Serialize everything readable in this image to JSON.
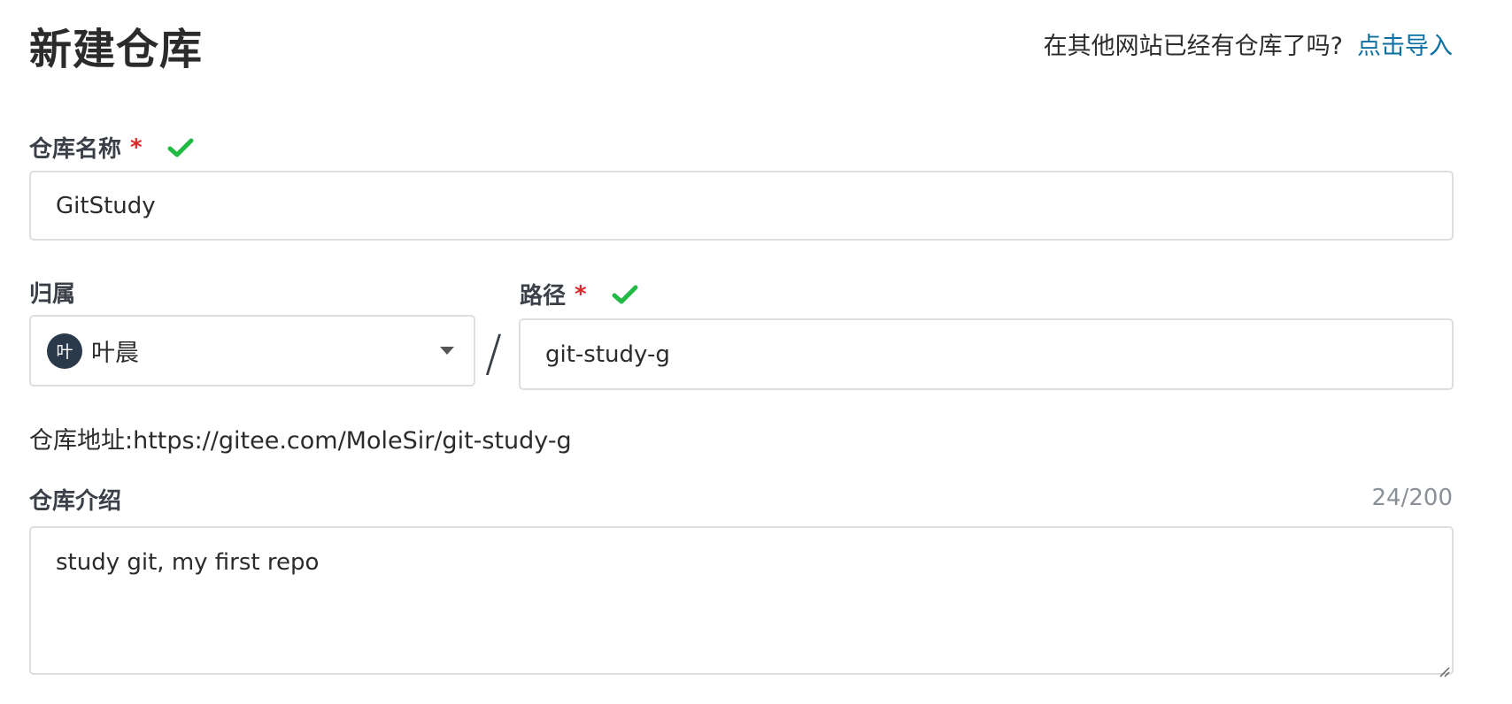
{
  "header": {
    "title": "新建仓库",
    "import_hint": "在其他网站已经有仓库了吗?",
    "import_link": "点击导入"
  },
  "repo_name": {
    "label": "仓库名称",
    "required_mark": "*",
    "value": "GitStudy",
    "valid_icon": "check-icon"
  },
  "owner": {
    "label": "归属",
    "avatar_text": "叶",
    "selected": "叶晨",
    "dropdown_icon": "caret-down-icon"
  },
  "separator": "/",
  "path": {
    "label": "路径",
    "required_mark": "*",
    "value": "git-study-g",
    "valid_icon": "check-icon"
  },
  "address": {
    "text": "仓库地址:https://gitee.com/MoleSir/git-study-g"
  },
  "description": {
    "label": "仓库介绍",
    "count": "24/200",
    "value": "study git, my first repo"
  },
  "colors": {
    "link": "#0c6fa2",
    "required": "#db2828",
    "valid": "#21ba45",
    "border": "#dedede",
    "avatar_bg": "#2b3a4a"
  }
}
